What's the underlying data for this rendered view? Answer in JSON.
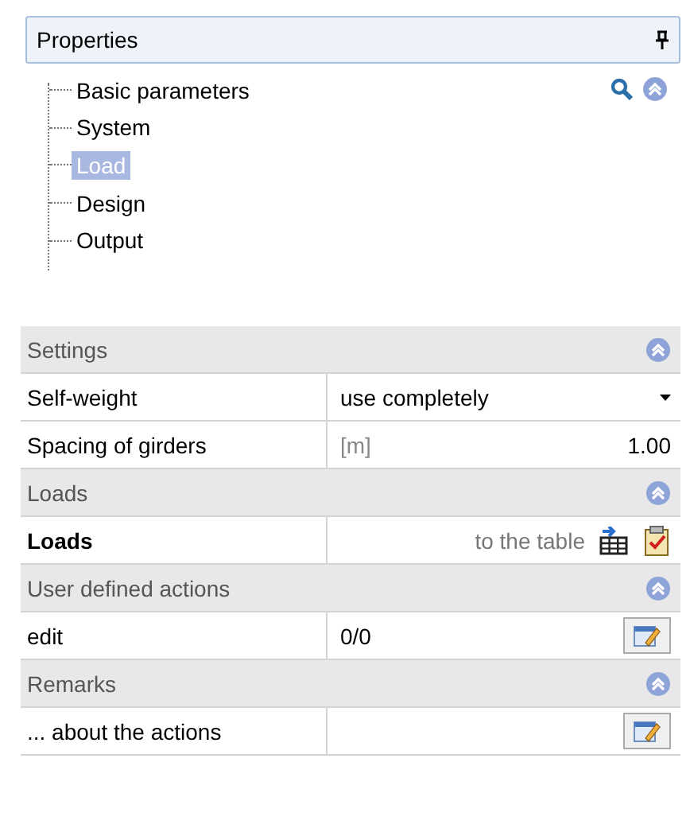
{
  "panel": {
    "title": "Properties"
  },
  "tree": [
    {
      "label": "Basic parameters",
      "selected": false
    },
    {
      "label": "System",
      "selected": false
    },
    {
      "label": "Load",
      "selected": true
    },
    {
      "label": "Design",
      "selected": false
    },
    {
      "label": "Output",
      "selected": false
    }
  ],
  "sections": [
    {
      "title": "Settings",
      "expanded": true,
      "rows": [
        {
          "kind": "dropdown",
          "label": "Self-weight",
          "value": "use completely"
        },
        {
          "kind": "unit",
          "label": "Spacing of girders",
          "unit": "[m]",
          "value": "1.00"
        }
      ]
    },
    {
      "title": "Loads",
      "expanded": true,
      "rows": [
        {
          "kind": "action",
          "label": "Loads",
          "bold": true,
          "value": "to the table"
        }
      ]
    },
    {
      "title": "User defined actions",
      "expanded": true,
      "rows": [
        {
          "kind": "edit",
          "label": "edit",
          "value": "0/0"
        }
      ]
    },
    {
      "title": "Remarks",
      "expanded": true,
      "rows": [
        {
          "kind": "edit",
          "label": "... about the actions"
        }
      ]
    }
  ]
}
